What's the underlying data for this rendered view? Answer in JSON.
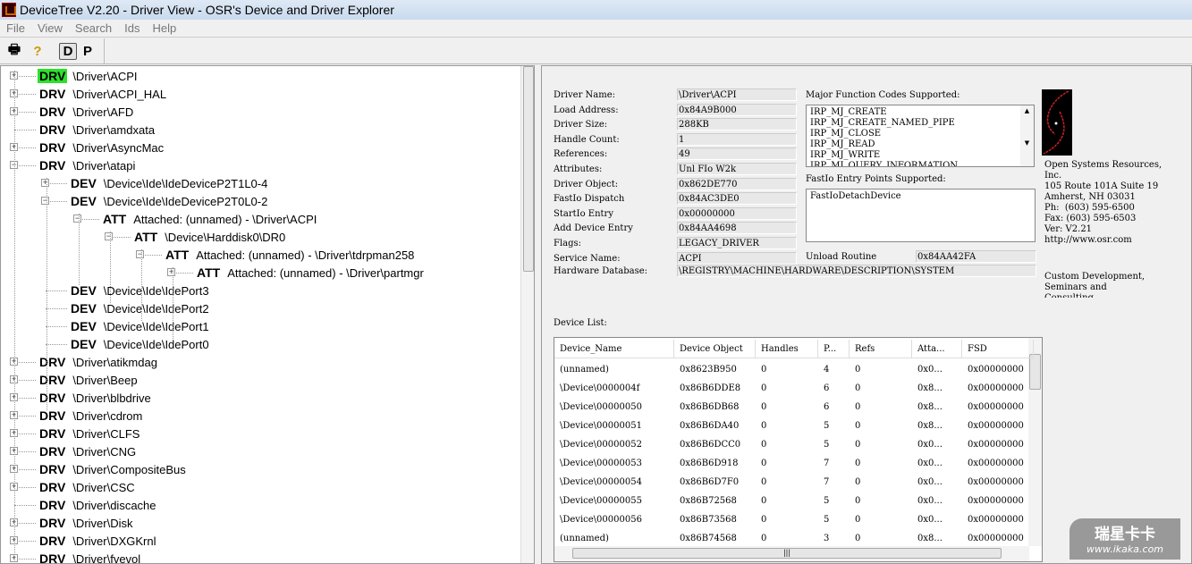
{
  "window": {
    "title": "DeviceTree V2.20 - Driver View - OSR's Device and Driver Explorer"
  },
  "menu": [
    "File",
    "View",
    "Search",
    "Ids",
    "Help"
  ],
  "toolbar": {
    "print": "print-icon",
    "help": "help-icon",
    "d": "D",
    "p": "P"
  },
  "tree": [
    {
      "level": 0,
      "tag": "DRV",
      "text": "\\Driver\\ACPI",
      "exp": "+",
      "selected": true
    },
    {
      "level": 0,
      "tag": "DRV",
      "text": "\\Driver\\ACPI_HAL",
      "exp": "+"
    },
    {
      "level": 0,
      "tag": "DRV",
      "text": "\\Driver\\AFD",
      "exp": "+"
    },
    {
      "level": 0,
      "tag": "DRV",
      "text": "\\Driver\\amdxata",
      "exp": ""
    },
    {
      "level": 0,
      "tag": "DRV",
      "text": "\\Driver\\AsyncMac",
      "exp": "+"
    },
    {
      "level": 0,
      "tag": "DRV",
      "text": "\\Driver\\atapi",
      "exp": "-"
    },
    {
      "level": 1,
      "tag": "DEV",
      "text": "\\Device\\Ide\\IdeDeviceP2T1L0-4",
      "exp": "+"
    },
    {
      "level": 1,
      "tag": "DEV",
      "text": "\\Device\\Ide\\IdeDeviceP2T0L0-2",
      "exp": "-"
    },
    {
      "level": 2,
      "tag": "ATT",
      "text": "Attached: (unnamed) - \\Driver\\ACPI",
      "exp": "-"
    },
    {
      "level": 3,
      "tag": "ATT",
      "text": "\\Device\\Harddisk0\\DR0",
      "exp": "-"
    },
    {
      "level": 4,
      "tag": "ATT",
      "text": "Attached: (unnamed) - \\Driver\\tdrpman258",
      "exp": "-"
    },
    {
      "level": 5,
      "tag": "ATT",
      "text": "Attached: (unnamed) - \\Driver\\partmgr",
      "exp": "+"
    },
    {
      "level": 1,
      "tag": "DEV",
      "text": "\\Device\\Ide\\IdePort3",
      "exp": ""
    },
    {
      "level": 1,
      "tag": "DEV",
      "text": "\\Device\\Ide\\IdePort2",
      "exp": ""
    },
    {
      "level": 1,
      "tag": "DEV",
      "text": "\\Device\\Ide\\IdePort1",
      "exp": ""
    },
    {
      "level": 1,
      "tag": "DEV",
      "text": "\\Device\\Ide\\IdePort0",
      "exp": ""
    },
    {
      "level": 0,
      "tag": "DRV",
      "text": "\\Driver\\atikmdag",
      "exp": "+"
    },
    {
      "level": 0,
      "tag": "DRV",
      "text": "\\Driver\\Beep",
      "exp": "+"
    },
    {
      "level": 0,
      "tag": "DRV",
      "text": "\\Driver\\blbdrive",
      "exp": "+"
    },
    {
      "level": 0,
      "tag": "DRV",
      "text": "\\Driver\\cdrom",
      "exp": "+"
    },
    {
      "level": 0,
      "tag": "DRV",
      "text": "\\Driver\\CLFS",
      "exp": "+"
    },
    {
      "level": 0,
      "tag": "DRV",
      "text": "\\Driver\\CNG",
      "exp": "+"
    },
    {
      "level": 0,
      "tag": "DRV",
      "text": "\\Driver\\CompositeBus",
      "exp": "+"
    },
    {
      "level": 0,
      "tag": "DRV",
      "text": "\\Driver\\CSC",
      "exp": "+"
    },
    {
      "level": 0,
      "tag": "DRV",
      "text": "\\Driver\\discache",
      "exp": ""
    },
    {
      "level": 0,
      "tag": "DRV",
      "text": "\\Driver\\Disk",
      "exp": "+"
    },
    {
      "level": 0,
      "tag": "DRV",
      "text": "\\Driver\\DXGKrnl",
      "exp": "+"
    },
    {
      "level": 0,
      "tag": "DRV",
      "text": "\\Driver\\fvevol",
      "exp": "+"
    }
  ],
  "details": {
    "fields": [
      {
        "label": "Driver Name:",
        "value": "\\Driver\\ACPI"
      },
      {
        "label": "Load Address:",
        "value": "0x84A9B000"
      },
      {
        "label": "Driver Size:",
        "value": "288KB"
      },
      {
        "label": "Handle Count:",
        "value": "1"
      },
      {
        "label": "References:",
        "value": "49"
      },
      {
        "label": "Attributes:",
        "value": "Unl FIo W2k"
      },
      {
        "label": "Driver Object:",
        "value": "0x862DE770"
      },
      {
        "label": "FastIo Dispatch",
        "value": "0x84AC3DE0"
      },
      {
        "label": "StartIo Entry",
        "value": "0x00000000"
      },
      {
        "label": "Add Device Entry",
        "value": "0x84AA4698"
      },
      {
        "label": "Flags:",
        "value": "LEGACY_DRIVER"
      },
      {
        "label": "Service Name:",
        "value": "ACPI"
      }
    ],
    "hardware_db_label": "Hardware Database:",
    "hardware_db": "\\REGISTRY\\MACHINE\\HARDWARE\\DESCRIPTION\\SYSTEM",
    "major_label": "Major Function Codes Supported:",
    "major": [
      "IRP_MJ_CREATE",
      "IRP_MJ_CREATE_NAMED_PIPE",
      "IRP_MJ_CLOSE",
      "IRP_MJ_READ",
      "IRP_MJ_WRITE",
      "IRP_MJ_QUERY_INFORMATION"
    ],
    "fastio_label": "FastIo Entry Points Supported:",
    "fastio": [
      "FastIoDetachDevice"
    ],
    "unload_label": "Unload Routine",
    "unload": "0x84AA42FA"
  },
  "about": {
    "lines": [
      "Open Systems Resources,",
      "Inc.",
      "105 Route 101A Suite 19",
      "Amherst, NH 03031",
      "Ph:  (603) 595-6500",
      "Fax: (603) 595-6503",
      "Ver: V2.21",
      "http://www.osr.com"
    ],
    "promo": [
      "Custom Development,",
      "Seminars and",
      "Consulting"
    ]
  },
  "device_list": {
    "label": "Device List:",
    "columns": [
      "Device_Name",
      "Device Object",
      "Handles",
      "P...",
      "Refs",
      "Atta...",
      "FSD"
    ],
    "rows": [
      [
        "(unnamed)",
        "0x8623B950",
        "0",
        "4",
        "0",
        "0x0...",
        "0x00000000"
      ],
      [
        "\\Device\\0000004f",
        "0x86B6DDE8",
        "0",
        "6",
        "0",
        "0x8...",
        "0x00000000"
      ],
      [
        "\\Device\\00000050",
        "0x86B6DB68",
        "0",
        "6",
        "0",
        "0x8...",
        "0x00000000"
      ],
      [
        "\\Device\\00000051",
        "0x86B6DA40",
        "0",
        "5",
        "0",
        "0x8...",
        "0x00000000"
      ],
      [
        "\\Device\\00000052",
        "0x86B6DCC0",
        "0",
        "5",
        "0",
        "0x0...",
        "0x00000000"
      ],
      [
        "\\Device\\00000053",
        "0x86B6D918",
        "0",
        "7",
        "0",
        "0x0...",
        "0x00000000"
      ],
      [
        "\\Device\\00000054",
        "0x86B6D7F0",
        "0",
        "7",
        "0",
        "0x0...",
        "0x00000000"
      ],
      [
        "\\Device\\00000055",
        "0x86B72568",
        "0",
        "5",
        "0",
        "0x0...",
        "0x00000000"
      ],
      [
        "\\Device\\00000056",
        "0x86B73568",
        "0",
        "5",
        "0",
        "0x0...",
        "0x00000000"
      ],
      [
        "(unnamed)",
        "0x86B74568",
        "0",
        "3",
        "0",
        "0x8...",
        "0x00000000"
      ]
    ]
  },
  "watermark": {
    "cn": "瑞星卡卡",
    "url": "www.ikaka.com"
  },
  "colors": {
    "selected_tag": "#2de02d"
  }
}
